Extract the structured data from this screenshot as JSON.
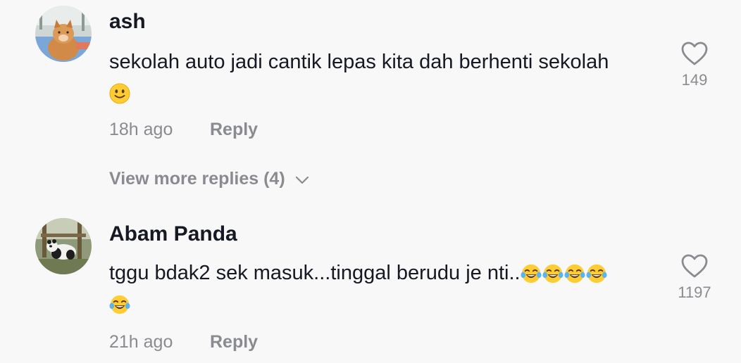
{
  "comments": [
    {
      "username": "ash",
      "text": "sekolah auto jadi cantik lepas kita dah berhenti sekolah",
      "emojis": [
        "slightly-smiling-face"
      ],
      "time": "18h ago",
      "reply_label": "Reply",
      "likes": "149",
      "view_more": "View more replies (4)"
    },
    {
      "username": "Abam Panda",
      "text": "tggu bdak2 sek masuk...tinggal berudu je nti..",
      "emojis": [
        "tears-of-joy",
        "tears-of-joy",
        "tears-of-joy",
        "tears-of-joy",
        "tears-of-joy"
      ],
      "time": "21h ago",
      "reply_label": "Reply",
      "likes": "1197"
    }
  ],
  "colors": {
    "background": "#f8f8f8",
    "primary_text": "#161823",
    "secondary_text": "#8a8b91"
  }
}
